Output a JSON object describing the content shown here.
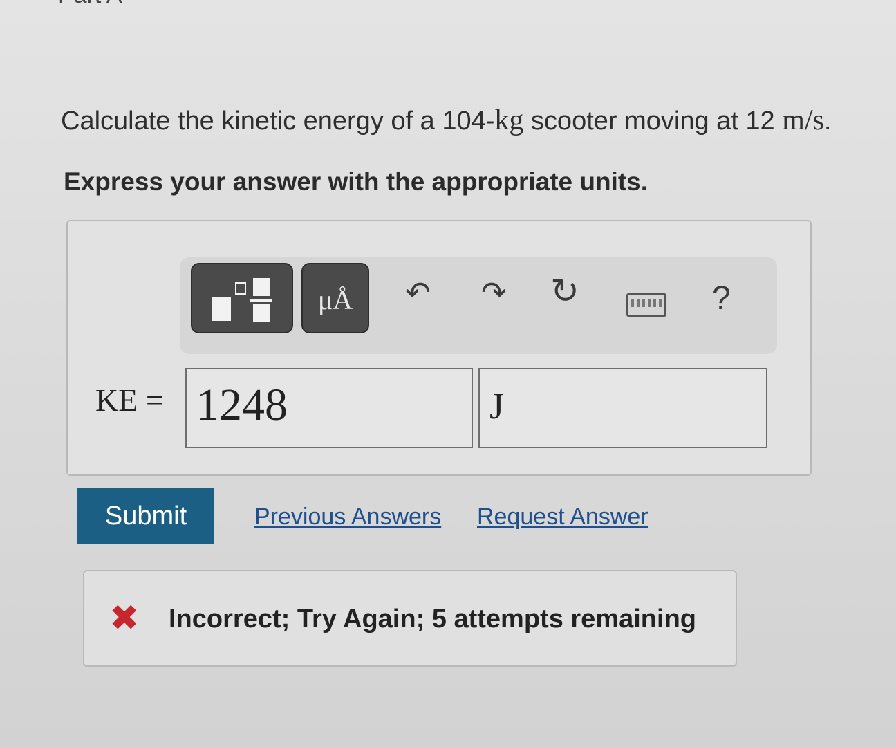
{
  "part_title": "Part A",
  "question": {
    "text_before": "Calculate the kinetic energy of a 104-",
    "mass_unit": "kg",
    "text_middle": " scooter moving at 12 ",
    "speed_unit": "m/s",
    "text_after": "."
  },
  "instruction": "Express your answer with the appropriate units.",
  "toolbar": {
    "units_label": "μÅ",
    "undo_icon": "↶",
    "redo_icon": "↷",
    "reset_icon": "↻",
    "help_label": "?"
  },
  "answer": {
    "variable_label": "KE =",
    "value": "1248",
    "unit": "J"
  },
  "actions": {
    "submit_label": "Submit",
    "previous_answers": "Previous Answers",
    "request_answer": "Request Answer"
  },
  "feedback": {
    "icon": "✖",
    "message": "Incorrect; Try Again; 5 attempts remaining",
    "icon_color": "#c8262f"
  },
  "colors": {
    "submit_bg": "#1b5f84",
    "link": "#1f4f8c"
  }
}
